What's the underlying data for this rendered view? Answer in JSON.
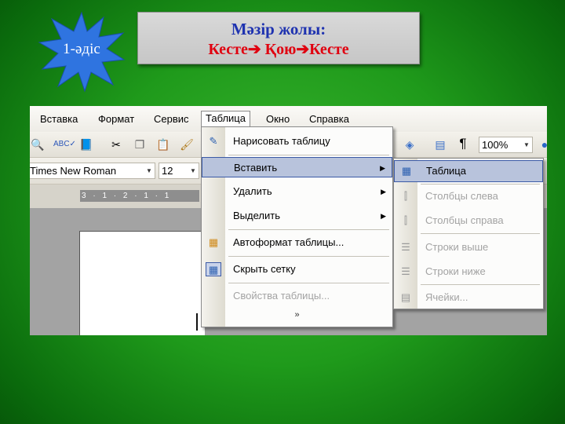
{
  "slide": {
    "badge": "1-әдіс",
    "title_line1": "Мәзір жолы:",
    "title_line2": "Кесте➔ Қою➔Кесте",
    "colors": {
      "title_blue": "#1f33b0",
      "title_red": "#e0000f",
      "badge_blue": "#2f74e0",
      "background_green": "#1f9a1b"
    }
  },
  "word": {
    "menubar": [
      "Вставка",
      "Формат",
      "Сервис",
      "Таблица",
      "Окно",
      "Справка"
    ],
    "toolbar": {
      "zoom": "100%",
      "font": "Times New Roman",
      "size": "12",
      "paragraph_mark": "¶"
    },
    "ruler": "3 · 1 · 2 · 1 · 1",
    "table_menu": [
      {
        "label": "Нарисовать таблицу",
        "icon": "draw-table-icon"
      },
      {
        "label": "Вставить",
        "icon": "",
        "submenu": true,
        "highlighted": true
      },
      {
        "label": "Удалить",
        "icon": "",
        "submenu": true
      },
      {
        "label": "Выделить",
        "icon": "",
        "submenu": true
      },
      {
        "label": "Автоформат таблицы...",
        "icon": "table-autoformat-icon"
      },
      {
        "label": "Скрыть сетку",
        "icon": "hide-gridlines-icon"
      },
      {
        "label": "Свойства таблицы...",
        "icon": "",
        "disabled": true
      }
    ],
    "expand_glyph": "»",
    "insert_submenu": [
      {
        "label": "Таблица",
        "icon": "insert-table-icon",
        "highlighted": true
      },
      {
        "label": "Столбцы слева",
        "icon": "columns-left-icon",
        "disabled": true
      },
      {
        "label": "Столбцы справа",
        "icon": "columns-right-icon",
        "disabled": true
      },
      {
        "label": "Строки выше",
        "icon": "rows-above-icon",
        "disabled": true
      },
      {
        "label": "Строки ниже",
        "icon": "rows-below-icon",
        "disabled": true
      },
      {
        "label": "Ячейки...",
        "icon": "cells-icon",
        "disabled": true
      }
    ]
  }
}
